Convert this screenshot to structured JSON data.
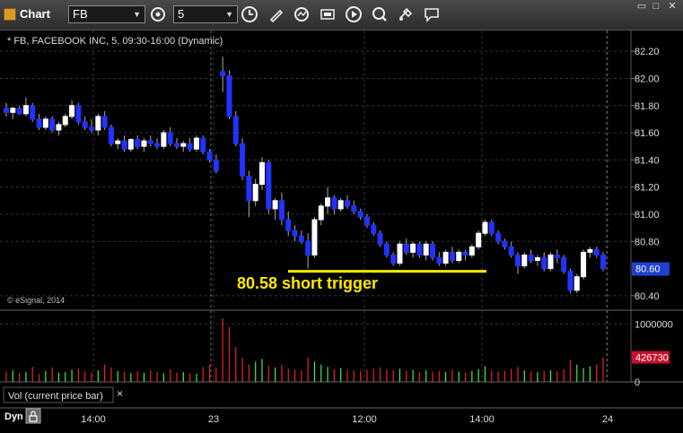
{
  "window": {
    "title": "Chart",
    "symbol_value": "FB",
    "interval_value": "5",
    "icons": [
      "clock-settings-icon",
      "time-icon",
      "draw-pencil-icon",
      "refresh-icon",
      "insert-study-icon",
      "replay-icon",
      "zoom-icon",
      "tools-icon",
      "comment-icon"
    ],
    "controls": [
      "restore-icon",
      "maximize-icon",
      "close-icon"
    ]
  },
  "chart_data": {
    "type": "candlestick",
    "title": "* FB, FACEBOOK INC, 5, 09:30-16:00 (Dynamic)",
    "watermark": "© eSignal, 2014",
    "annotation": "80.58 short trigger",
    "trigger_level": 80.58,
    "last_price": "80.60",
    "ylim": [
      80.32,
      82.3
    ],
    "y_ticks": [
      "82.20",
      "82.00",
      "81.80",
      "81.60",
      "81.40",
      "81.20",
      "81.00",
      "80.80",
      "80.40"
    ],
    "x_labels": [
      "14:00",
      "23",
      "12:00",
      "14:00",
      "24"
    ],
    "candles": [
      [
        81.78,
        81.82,
        81.72,
        81.75
      ],
      [
        81.75,
        81.79,
        81.7,
        81.78
      ],
      [
        81.78,
        81.8,
        81.73,
        81.74
      ],
      [
        81.74,
        81.86,
        81.72,
        81.8
      ],
      [
        81.8,
        81.82,
        81.68,
        81.7
      ],
      [
        81.7,
        81.74,
        81.62,
        81.64
      ],
      [
        81.64,
        81.72,
        81.62,
        81.7
      ],
      [
        81.7,
        81.72,
        81.6,
        81.62
      ],
      [
        81.62,
        81.68,
        81.58,
        81.66
      ],
      [
        81.66,
        81.74,
        81.64,
        81.72
      ],
      [
        81.72,
        81.84,
        81.7,
        81.8
      ],
      [
        81.8,
        81.82,
        81.66,
        81.68
      ],
      [
        81.68,
        81.72,
        81.62,
        81.64
      ],
      [
        81.64,
        81.7,
        81.6,
        81.62
      ],
      [
        81.62,
        81.74,
        81.58,
        81.72
      ],
      [
        81.72,
        81.76,
        81.62,
        81.64
      ],
      [
        81.64,
        81.66,
        81.5,
        81.52
      ],
      [
        81.52,
        81.56,
        81.48,
        81.54
      ],
      [
        81.54,
        81.58,
        81.46,
        81.48
      ],
      [
        81.48,
        81.56,
        81.46,
        81.55
      ],
      [
        81.55,
        81.58,
        81.48,
        81.5
      ],
      [
        81.5,
        81.56,
        81.46,
        81.54
      ],
      [
        81.54,
        81.58,
        81.5,
        81.52
      ],
      [
        81.52,
        81.56,
        81.48,
        81.5
      ],
      [
        81.5,
        81.62,
        81.48,
        81.6
      ],
      [
        81.6,
        81.64,
        81.5,
        81.52
      ],
      [
        81.52,
        81.56,
        81.48,
        81.5
      ],
      [
        81.5,
        81.54,
        81.46,
        81.52
      ],
      [
        81.52,
        81.56,
        81.46,
        81.48
      ],
      [
        81.48,
        81.58,
        81.46,
        81.56
      ],
      [
        81.56,
        81.58,
        81.44,
        81.46
      ],
      [
        81.46,
        81.48,
        81.38,
        81.4
      ],
      [
        81.4,
        81.44,
        81.3,
        81.32
      ],
      [
        82.05,
        82.16,
        81.9,
        82.02
      ],
      [
        82.02,
        82.06,
        81.7,
        81.72
      ],
      [
        81.72,
        81.76,
        81.5,
        81.52
      ],
      [
        81.52,
        81.56,
        81.25,
        81.28
      ],
      [
        81.28,
        81.32,
        80.98,
        81.1
      ],
      [
        81.1,
        81.26,
        81.06,
        81.22
      ],
      [
        81.22,
        81.42,
        81.18,
        81.38
      ],
      [
        81.38,
        81.4,
        81.0,
        81.04
      ],
      [
        81.04,
        81.12,
        80.96,
        81.1
      ],
      [
        81.1,
        81.16,
        80.92,
        80.96
      ],
      [
        80.96,
        81.02,
        80.84,
        80.88
      ],
      [
        80.88,
        80.92,
        80.8,
        80.84
      ],
      [
        80.84,
        80.88,
        80.78,
        80.8
      ],
      [
        80.8,
        80.86,
        80.6,
        80.7
      ],
      [
        80.7,
        80.98,
        80.68,
        80.96
      ],
      [
        80.96,
        81.08,
        80.92,
        81.06
      ],
      [
        81.06,
        81.2,
        81.0,
        81.12
      ],
      [
        81.12,
        81.14,
        81.0,
        81.04
      ],
      [
        81.04,
        81.12,
        81.02,
        81.1
      ],
      [
        81.1,
        81.14,
        81.04,
        81.06
      ],
      [
        81.06,
        81.1,
        81.0,
        81.02
      ],
      [
        81.02,
        81.04,
        80.96,
        80.98
      ],
      [
        80.98,
        81.0,
        80.9,
        80.92
      ],
      [
        80.92,
        80.94,
        80.84,
        80.86
      ],
      [
        80.86,
        80.88,
        80.76,
        80.78
      ],
      [
        80.78,
        80.8,
        80.68,
        80.7
      ],
      [
        80.7,
        80.72,
        80.62,
        80.64
      ],
      [
        80.64,
        80.8,
        80.62,
        80.78
      ],
      [
        80.78,
        80.82,
        80.7,
        80.72
      ],
      [
        80.72,
        80.8,
        80.68,
        80.78
      ],
      [
        80.78,
        80.8,
        80.68,
        80.7
      ],
      [
        80.7,
        80.8,
        80.66,
        80.78
      ],
      [
        80.78,
        80.8,
        80.66,
        80.68
      ],
      [
        80.68,
        80.72,
        80.62,
        80.64
      ],
      [
        80.64,
        80.74,
        80.62,
        80.72
      ],
      [
        80.72,
        80.76,
        80.64,
        80.66
      ],
      [
        80.66,
        80.74,
        80.64,
        80.72
      ],
      [
        80.72,
        80.74,
        80.66,
        80.7
      ],
      [
        80.7,
        80.78,
        80.68,
        80.76
      ],
      [
        80.76,
        80.88,
        80.74,
        80.86
      ],
      [
        80.86,
        80.96,
        80.84,
        80.94
      ],
      [
        80.94,
        80.96,
        80.84,
        80.86
      ],
      [
        80.86,
        80.88,
        80.78,
        80.8
      ],
      [
        80.8,
        80.82,
        80.74,
        80.76
      ],
      [
        80.76,
        80.8,
        80.68,
        80.7
      ],
      [
        80.7,
        80.72,
        80.56,
        80.62
      ],
      [
        80.62,
        80.72,
        80.6,
        80.7
      ],
      [
        80.7,
        80.74,
        80.64,
        80.66
      ],
      [
        80.66,
        80.7,
        80.62,
        80.68
      ],
      [
        80.68,
        80.72,
        80.58,
        80.6
      ],
      [
        80.6,
        80.72,
        80.58,
        80.7
      ],
      [
        80.7,
        80.74,
        80.64,
        80.68
      ],
      [
        80.68,
        80.7,
        80.56,
        80.58
      ],
      [
        80.58,
        80.6,
        80.42,
        80.44
      ],
      [
        80.44,
        80.56,
        80.42,
        80.54
      ],
      [
        80.54,
        80.74,
        80.52,
        80.72
      ],
      [
        80.72,
        80.76,
        80.68,
        80.74
      ],
      [
        80.74,
        80.76,
        80.68,
        80.7
      ],
      [
        80.7,
        80.72,
        80.58,
        80.6
      ]
    ],
    "volume": {
      "label": "Vol (current price bar)",
      "last_value": "426730",
      "y_ticks": [
        "1000000",
        "0"
      ],
      "ylim": [
        0,
        1150000
      ],
      "values": [
        180000,
        200000,
        150000,
        170000,
        260000,
        140000,
        190000,
        250000,
        160000,
        170000,
        210000,
        230000,
        180000,
        160000,
        200000,
        300000,
        250000,
        190000,
        170000,
        150000,
        180000,
        160000,
        200000,
        170000,
        150000,
        220000,
        160000,
        170000,
        150000,
        140000,
        260000,
        300000,
        250000,
        1100000,
        950000,
        600000,
        420000,
        300000,
        350000,
        400000,
        280000,
        250000,
        300000,
        230000,
        210000,
        200000,
        420000,
        350000,
        300000,
        260000,
        220000,
        240000,
        210000,
        200000,
        190000,
        210000,
        230000,
        250000,
        220000,
        200000,
        230000,
        190000,
        210000,
        170000,
        200000,
        180000,
        190000,
        170000,
        210000,
        180000,
        160000,
        190000,
        220000,
        270000,
        200000,
        180000,
        190000,
        230000,
        260000,
        200000,
        180000,
        170000,
        190000,
        200000,
        180000,
        220000,
        380000,
        300000,
        240000,
        270000,
        300000,
        426730
      ]
    }
  },
  "footer": {
    "mode": "Dyn",
    "close_label": "×"
  }
}
